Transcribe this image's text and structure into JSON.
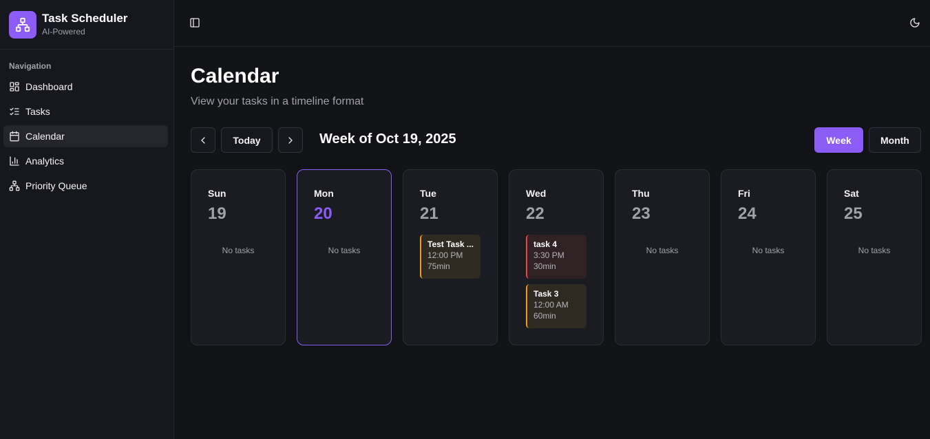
{
  "app": {
    "title": "Task Scheduler",
    "subtitle": "AI-Powered"
  },
  "sidebar": {
    "section_label": "Navigation",
    "items": [
      {
        "label": "Dashboard",
        "icon": "dashboard-icon"
      },
      {
        "label": "Tasks",
        "icon": "list-checks-icon"
      },
      {
        "label": "Calendar",
        "icon": "calendar-icon",
        "active": true
      },
      {
        "label": "Analytics",
        "icon": "bar-chart-icon"
      },
      {
        "label": "Priority Queue",
        "icon": "network-icon"
      }
    ]
  },
  "page": {
    "title": "Calendar",
    "subtitle": "View your tasks in a timeline format"
  },
  "toolbar": {
    "today_label": "Today",
    "week_label": "Week of Oct 19, 2025",
    "view_week": "Week",
    "view_month": "Month",
    "active_view": "Week"
  },
  "colors": {
    "accent": "#8b5cf6",
    "priority_medium": "#f59e0b",
    "priority_high": "#ef4444",
    "background": "#121317"
  },
  "empty_text": "No tasks",
  "days": [
    {
      "name": "Sun",
      "num": "19",
      "tasks": []
    },
    {
      "name": "Mon",
      "num": "20",
      "today": true,
      "tasks": []
    },
    {
      "name": "Tue",
      "num": "21",
      "tasks": [
        {
          "title": "Test Task ...",
          "time": "12:00 PM",
          "duration": "75min",
          "color": "amber"
        }
      ]
    },
    {
      "name": "Wed",
      "num": "22",
      "tasks": [
        {
          "title": "task 4",
          "time": "3:30 PM",
          "duration": "30min",
          "color": "red"
        },
        {
          "title": "Task 3",
          "time": "12:00 AM",
          "duration": "60min",
          "color": "amber"
        }
      ]
    },
    {
      "name": "Thu",
      "num": "23",
      "tasks": []
    },
    {
      "name": "Fri",
      "num": "24",
      "tasks": []
    },
    {
      "name": "Sat",
      "num": "25",
      "tasks": []
    }
  ]
}
